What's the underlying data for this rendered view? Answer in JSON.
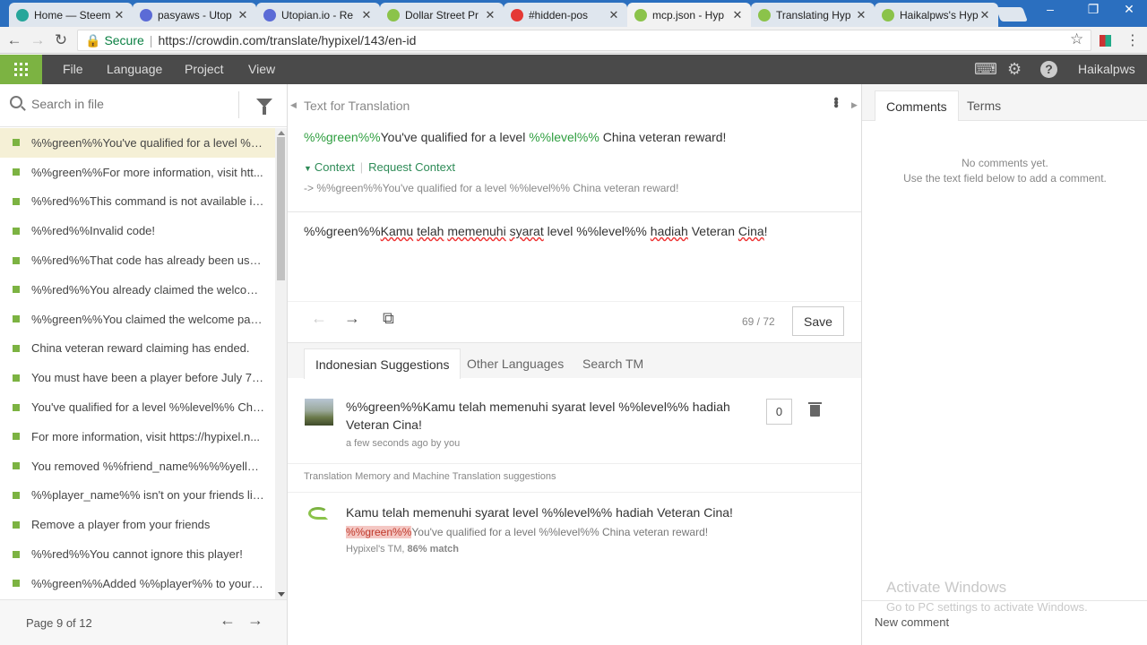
{
  "browser": {
    "tabs": [
      {
        "title": "Home — Steem",
        "color": "#26a69a",
        "active": false
      },
      {
        "title": "pasyaws - Utop",
        "color": "#5b6bd6",
        "active": false
      },
      {
        "title": "Utopian.io - Re",
        "color": "#5b6bd6",
        "active": false
      },
      {
        "title": "Dollar Street Pr",
        "color": "#8bc34a",
        "active": false
      },
      {
        "title": "#hidden-pos",
        "color": "#e53935",
        "active": false
      },
      {
        "title": "mcp.json - Hyp",
        "color": "#8bc34a",
        "active": true
      },
      {
        "title": "Translating Hyp",
        "color": "#8bc34a",
        "active": false
      },
      {
        "title": "Haikalpws's Hyp",
        "color": "#8bc34a",
        "active": false
      }
    ],
    "secure_label": "Secure",
    "url": "https://crowdin.com/translate/hypixel/143/en-id"
  },
  "appbar": {
    "menus": [
      "File",
      "Language",
      "Project",
      "View"
    ],
    "username": "Haikalpws"
  },
  "left": {
    "search_placeholder": "Search in file",
    "items": [
      "%%green%%You've qualified for a level %%...",
      "%%green%%For more information, visit htt...",
      "%%red%%This command is not available in ...",
      "%%red%%Invalid code!",
      "%%red%%That code has already been used!",
      "%%red%%You already claimed the welcom...",
      "%%green%%You claimed the welcome pack...",
      "China veteran reward claiming has ended.",
      "You must have been a player before July 7t...",
      "You've qualified for a level %%level%% Chin...",
      "For more information, visit https://hypixel.n...",
      "You removed %%friend_name%%%%yellow...",
      "%%player_name%% isn't on your friends list!",
      "Remove a player from your friends",
      "%%red%%You cannot ignore this player!",
      "%%green%%Added %%player%% to your ig..."
    ],
    "pager": "Page 9 of 12"
  },
  "center": {
    "source_heading": "Text for Translation",
    "source_text": {
      "ph1": "%%green%%",
      "t1": "You've qualified for a level ",
      "ph2": "%%level%%",
      "t2": " China veteran reward!"
    },
    "context_label": "Context",
    "request_context": "Request Context",
    "context_note": "-> %%green%%You've qualified for a level %%level%% China veteran reward!",
    "translation": {
      "p1": "%%green%%",
      "w1": "Kamu",
      "s1": " ",
      "w2": "telah",
      "s2": " ",
      "w3": "memenuhi",
      "s3": " ",
      "w4": "syarat",
      "t1": " level %%level%% ",
      "w5": "hadiah",
      "t2": " Veteran ",
      "w6": "Cina",
      "t3": "!"
    },
    "counter": "69 / 72",
    "save_label": "Save",
    "suggestion_tabs": [
      "Indonesian Suggestions",
      "Other Languages",
      "Search TM"
    ],
    "suggestion": {
      "text": "%%green%%Kamu telah memenuhi syarat level %%level%% hadiah Veteran Cina!",
      "meta": "a few seconds ago by you",
      "votes": "0"
    },
    "tm_heading": "Translation Memory and Machine Translation suggestions",
    "tm": {
      "text": "Kamu telah memenuhi syarat level %%level%% hadiah Veteran Cina!",
      "src_hl": "%%green%%",
      "src_rest": "You've qualified for a level %%level%% China veteran reward!",
      "source_name": "Hypixel's TM, ",
      "match": "86% match"
    }
  },
  "right": {
    "tabs": [
      "Comments",
      "Terms"
    ],
    "no_comments": "No comments yet.",
    "hint": "Use the text field below to add a comment.",
    "activate_title": "Activate Windows",
    "activate_sub": "Go to PC settings to activate Windows.",
    "new_comment": "New comment"
  }
}
